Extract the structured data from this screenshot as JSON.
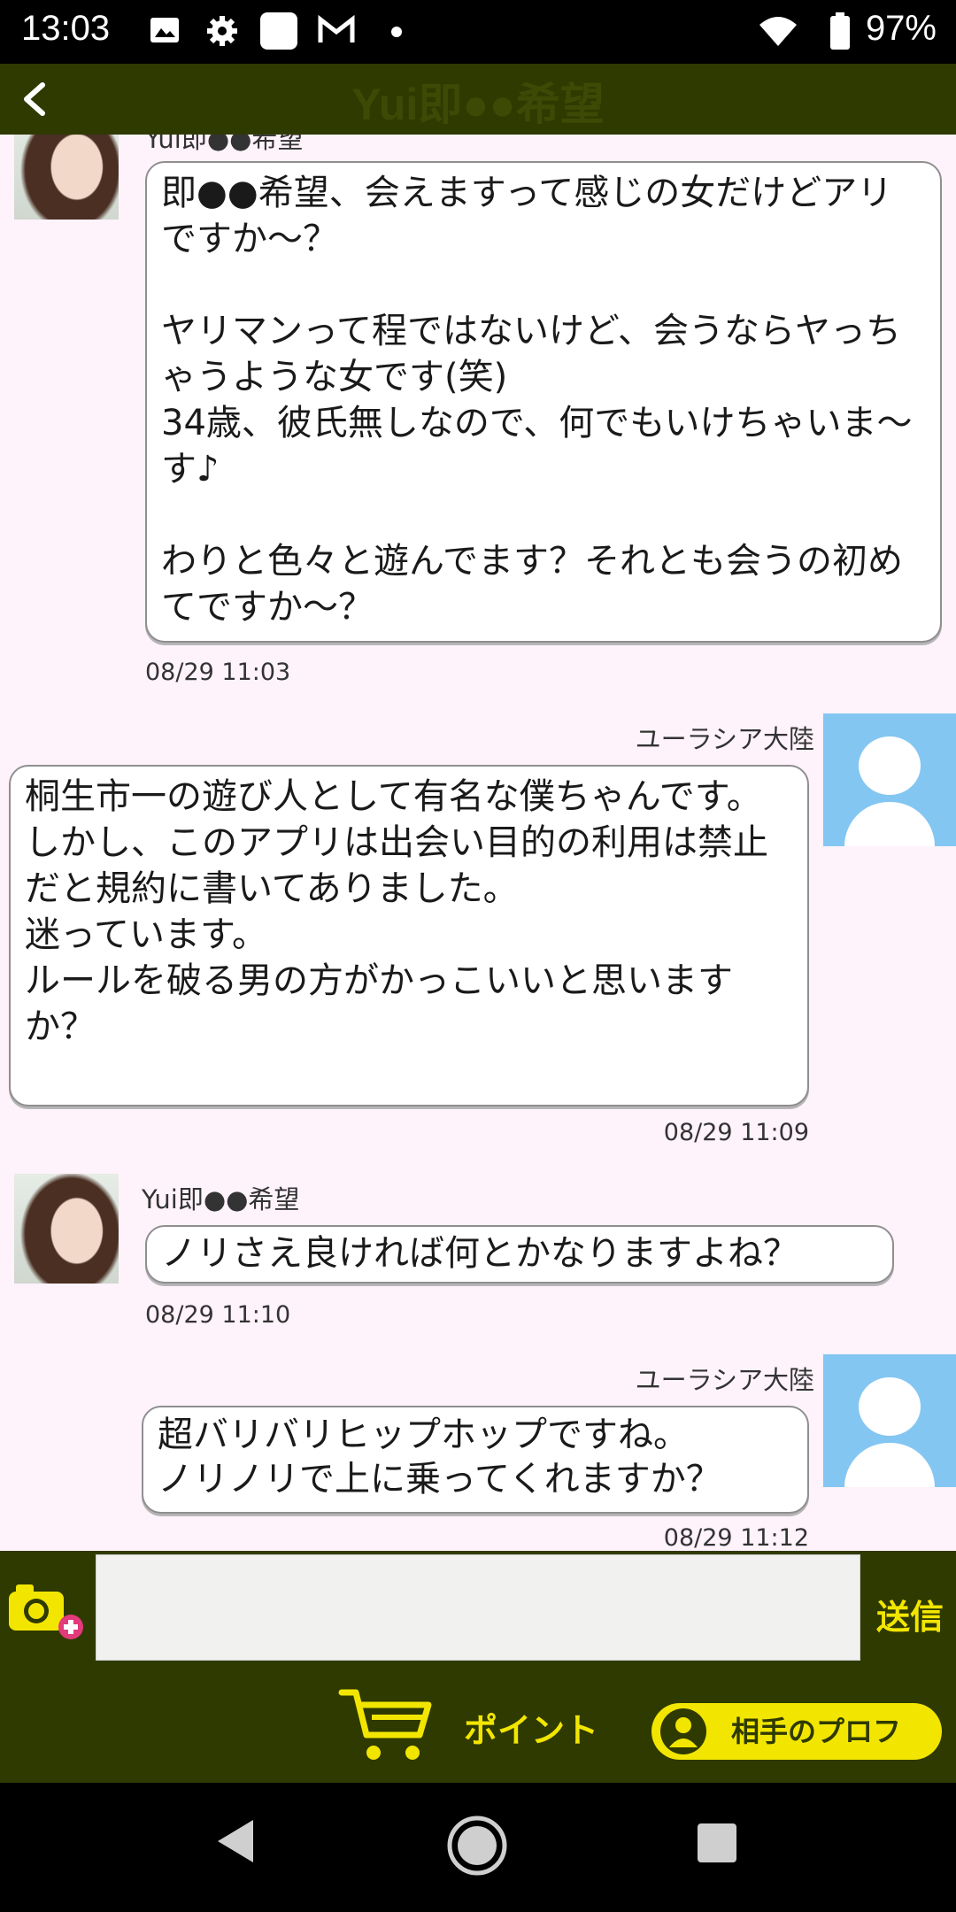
{
  "status_bar": {
    "time": "13:03",
    "battery": "97%"
  },
  "header": {
    "title": "Yui即●●希望"
  },
  "messages": [
    {
      "side": "left",
      "sender": "Yui即●●希望",
      "text": "即●●希望、会えますって感じの女だけどアリですか～？\n\nヤリマンって程ではないけど、会うならヤっちゃうような女です(笑)\n34歳、彼氏無しなので、何でもいけちゃいま～す♪\n\nわりと色々と遊んでます？それとも会うの初めてですか～？",
      "time": "08/29 11:03"
    },
    {
      "side": "right",
      "sender": "ユーラシア大陸",
      "text": "桐生市一の遊び人として有名な僕ちゃんです。\nしかし、このアプリは出会い目的の利用は禁止だと規約に書いてありました。\n迷っています。\nルールを破る男の方がかっこいいと思いますか？",
      "time": "08/29 11:09"
    },
    {
      "side": "left",
      "sender": "Yui即●●希望",
      "text": "ノリさえ良ければ何とかなりますよね？",
      "time": "08/29 11:10"
    },
    {
      "side": "right",
      "sender": "ユーラシア大陸",
      "text": "超バリバリヒップホップですね。\nノリノリで上に乗ってくれますか？",
      "time": "08/29 11:12"
    }
  ],
  "composer": {
    "message_value": "",
    "send_label": "送信",
    "points_label": "ポイント",
    "profile_label": "相手のプロフ"
  },
  "colors": {
    "header_bg": "#2f3a00",
    "accent_yellow": "#f2e600",
    "chat_bg": "#fff3fb",
    "avatar_blue": "#84c6f2"
  }
}
